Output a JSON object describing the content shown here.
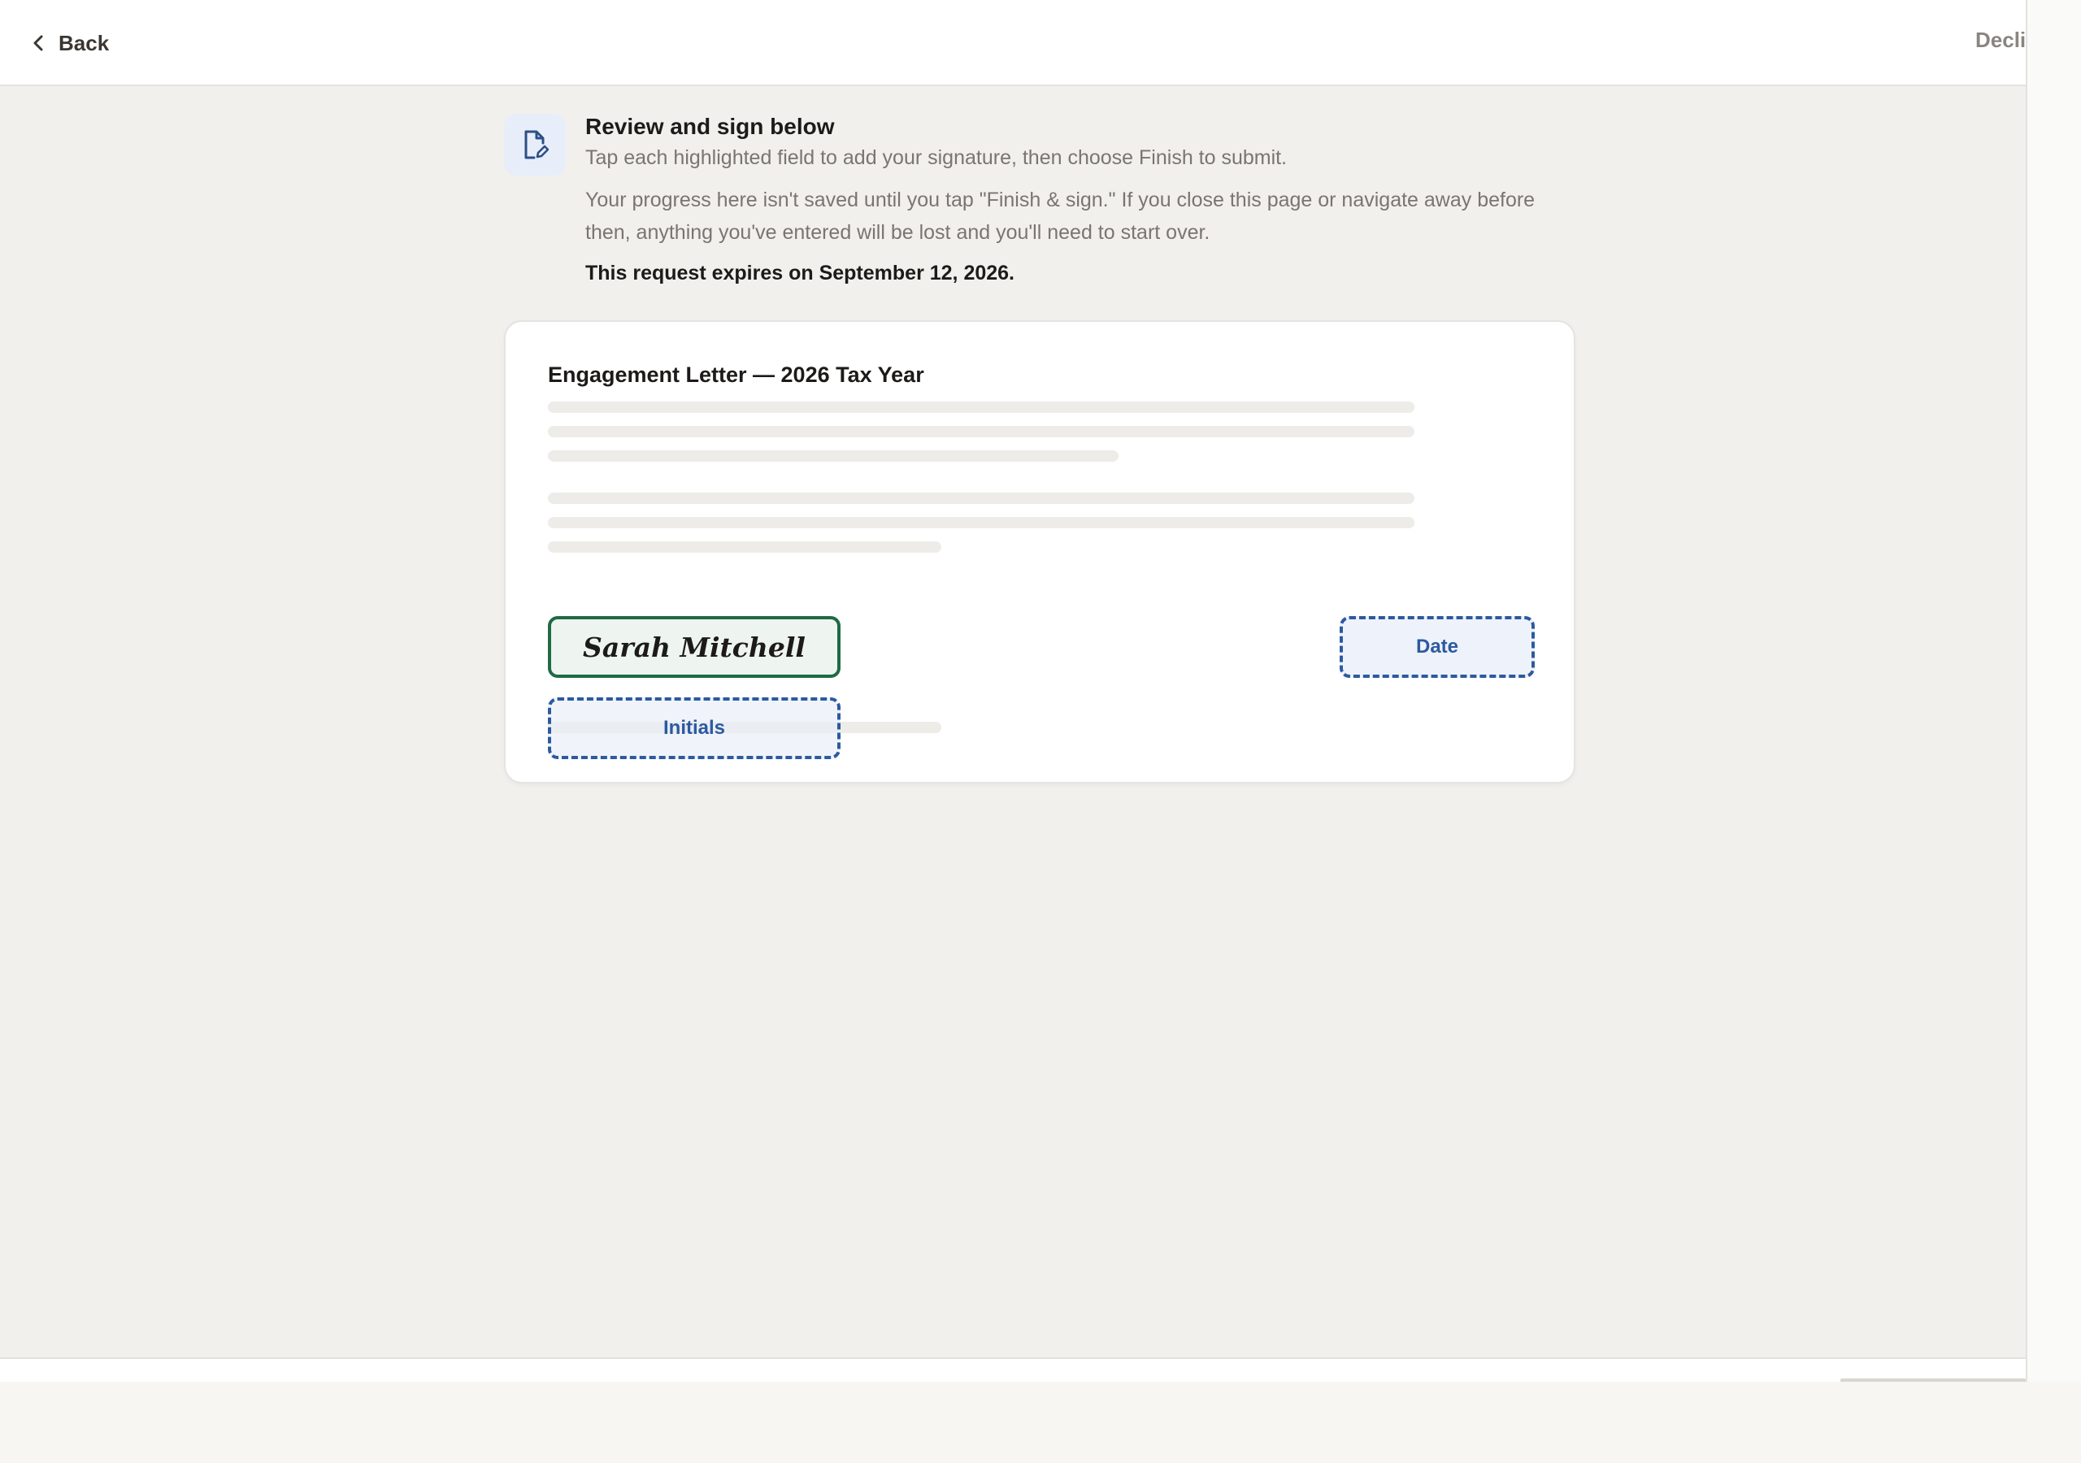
{
  "header": {
    "back_label": "Back",
    "decline_label": "Decli"
  },
  "intro": {
    "icon": "document-edit-icon",
    "title": "Review and sign below",
    "subtitle": "Tap each highlighted field to add your signature, then choose Finish to submit.",
    "warning": "Your progress here isn't saved until you tap \"Finish & sign.\" If you close this page or navigate away before then, anything you've entered will be lost and you'll need to start over.",
    "expiry": "This request expires on September 12, 2026."
  },
  "document": {
    "title": "Engagement Letter — 2026 Tax Year",
    "fields": {
      "signature_value": "Sarah Mitchell",
      "date_label": "Date",
      "initials_label": "Initials"
    }
  },
  "colors": {
    "signed_field": "#1f6a44",
    "pending_field": "#2c5aa0",
    "page_background": "#f1f0ed"
  }
}
